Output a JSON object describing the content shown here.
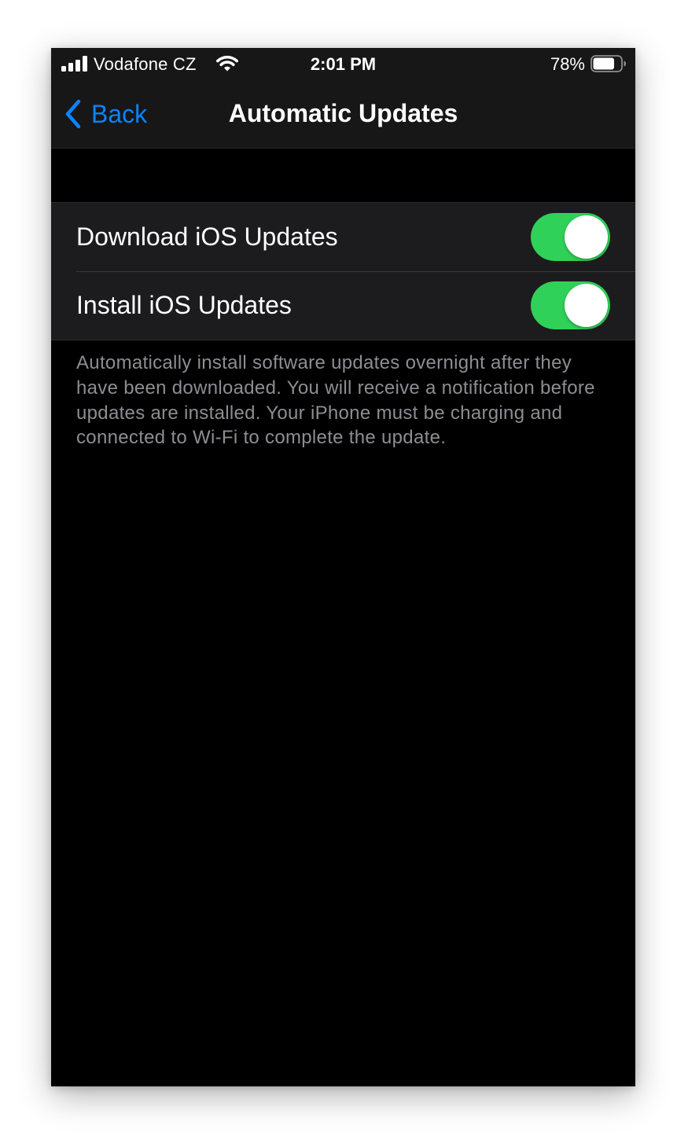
{
  "status_bar": {
    "carrier": "Vodafone CZ",
    "time": "2:01 PM",
    "battery_percent": "78%",
    "battery_level": 0.78,
    "icons": [
      "signal-icon",
      "wifi-icon",
      "battery-icon"
    ]
  },
  "nav": {
    "back_label": "Back",
    "title": "Automatic Updates",
    "back_icon": "chevron-left-icon"
  },
  "settings": {
    "rows": [
      {
        "label": "Download iOS Updates",
        "enabled": true
      },
      {
        "label": "Install iOS Updates",
        "enabled": true
      }
    ]
  },
  "footer": {
    "note": "Automatically install software updates overnight after they have been downloaded. You will receive a notification before updates are installed. Your iPhone must be charging and connected to Wi-Fi to complete the update."
  },
  "colors": {
    "accent": "#0a84ff",
    "toggle_on": "#30d158",
    "background": "#000000",
    "cell_background": "#1c1c1e",
    "secondary_text": "#8d8d93"
  }
}
